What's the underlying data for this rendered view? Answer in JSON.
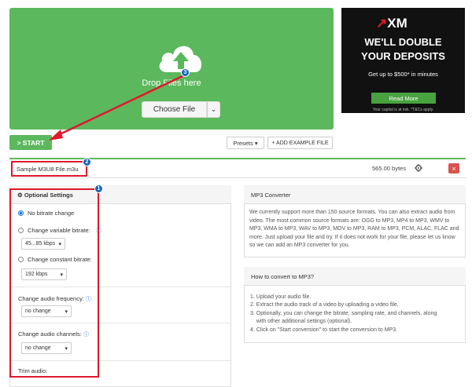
{
  "dropzone": {
    "drop_text": "Drop Files here",
    "choose_file": "Choose File",
    "choose_dropdown_icon": "chevron-down-icon",
    "upload_icon": "cloud-upload-icon"
  },
  "ad": {
    "logo_prefix": "↗",
    "logo_text": "XM",
    "headline_1": "WE'LL DOUBLE",
    "headline_2": "YOUR DEPOSITS",
    "subline": "Get up to $500* in minutes",
    "button": "Read More",
    "disclaimer": "Your capital is at risk. *T&Cs apply."
  },
  "toolbar": {
    "start": "> START",
    "presets": "Presets",
    "add_example": "+ ADD EXAMPLE FILE"
  },
  "file": {
    "name": "Sample M3U8 File.m3u",
    "size": "565.00 bytes",
    "remove": "×"
  },
  "options": {
    "title": "Optional Settings",
    "no_bitrate": "No bitrate change",
    "variable_bitrate": "Change variable bitrate:",
    "variable_value": "45...85 kbps",
    "constant_bitrate": "Change constant bitrate:",
    "constant_value": "192 kbps",
    "frequency_label": "Change audio frequency:",
    "frequency_value": "no change",
    "channels_label": "Change audio channels:",
    "channels_value": "no change",
    "trim_label": "Trim audio:",
    "info_icon": "info-icon"
  },
  "converter": {
    "title": "MP3 Converter",
    "body": "We currently support more than 150 source formats. You can also extract audio from video. The most common source formats are: OGG to MP3, MP4 to MP3, WMV to MP3, WMA to MP3, WAV to MP3, MOV to MP3, RAM to MP3, PCM, ALAC, FLAC and more. Just upload your file and try. If it does not work for your file, please let us know so we can add an MP3 converter for you."
  },
  "howto": {
    "title": "How to convert to MP3?",
    "steps": [
      "1. Upload your audio file.",
      "2. Extract the audio track of a video by uploading a video file.",
      "3. Optionally, you can change the bitrate, sampling rate, and channels, along",
      "    with other additional settings (optional).",
      "4. Click on \"Start conversion\" to start the conversion to MP3."
    ]
  },
  "badges": {
    "one": "1",
    "two": "2",
    "three": "3"
  },
  "colors": {
    "green": "#5cb85c",
    "annotation_red": "#e0182d",
    "badge_blue": "#1565c0"
  }
}
